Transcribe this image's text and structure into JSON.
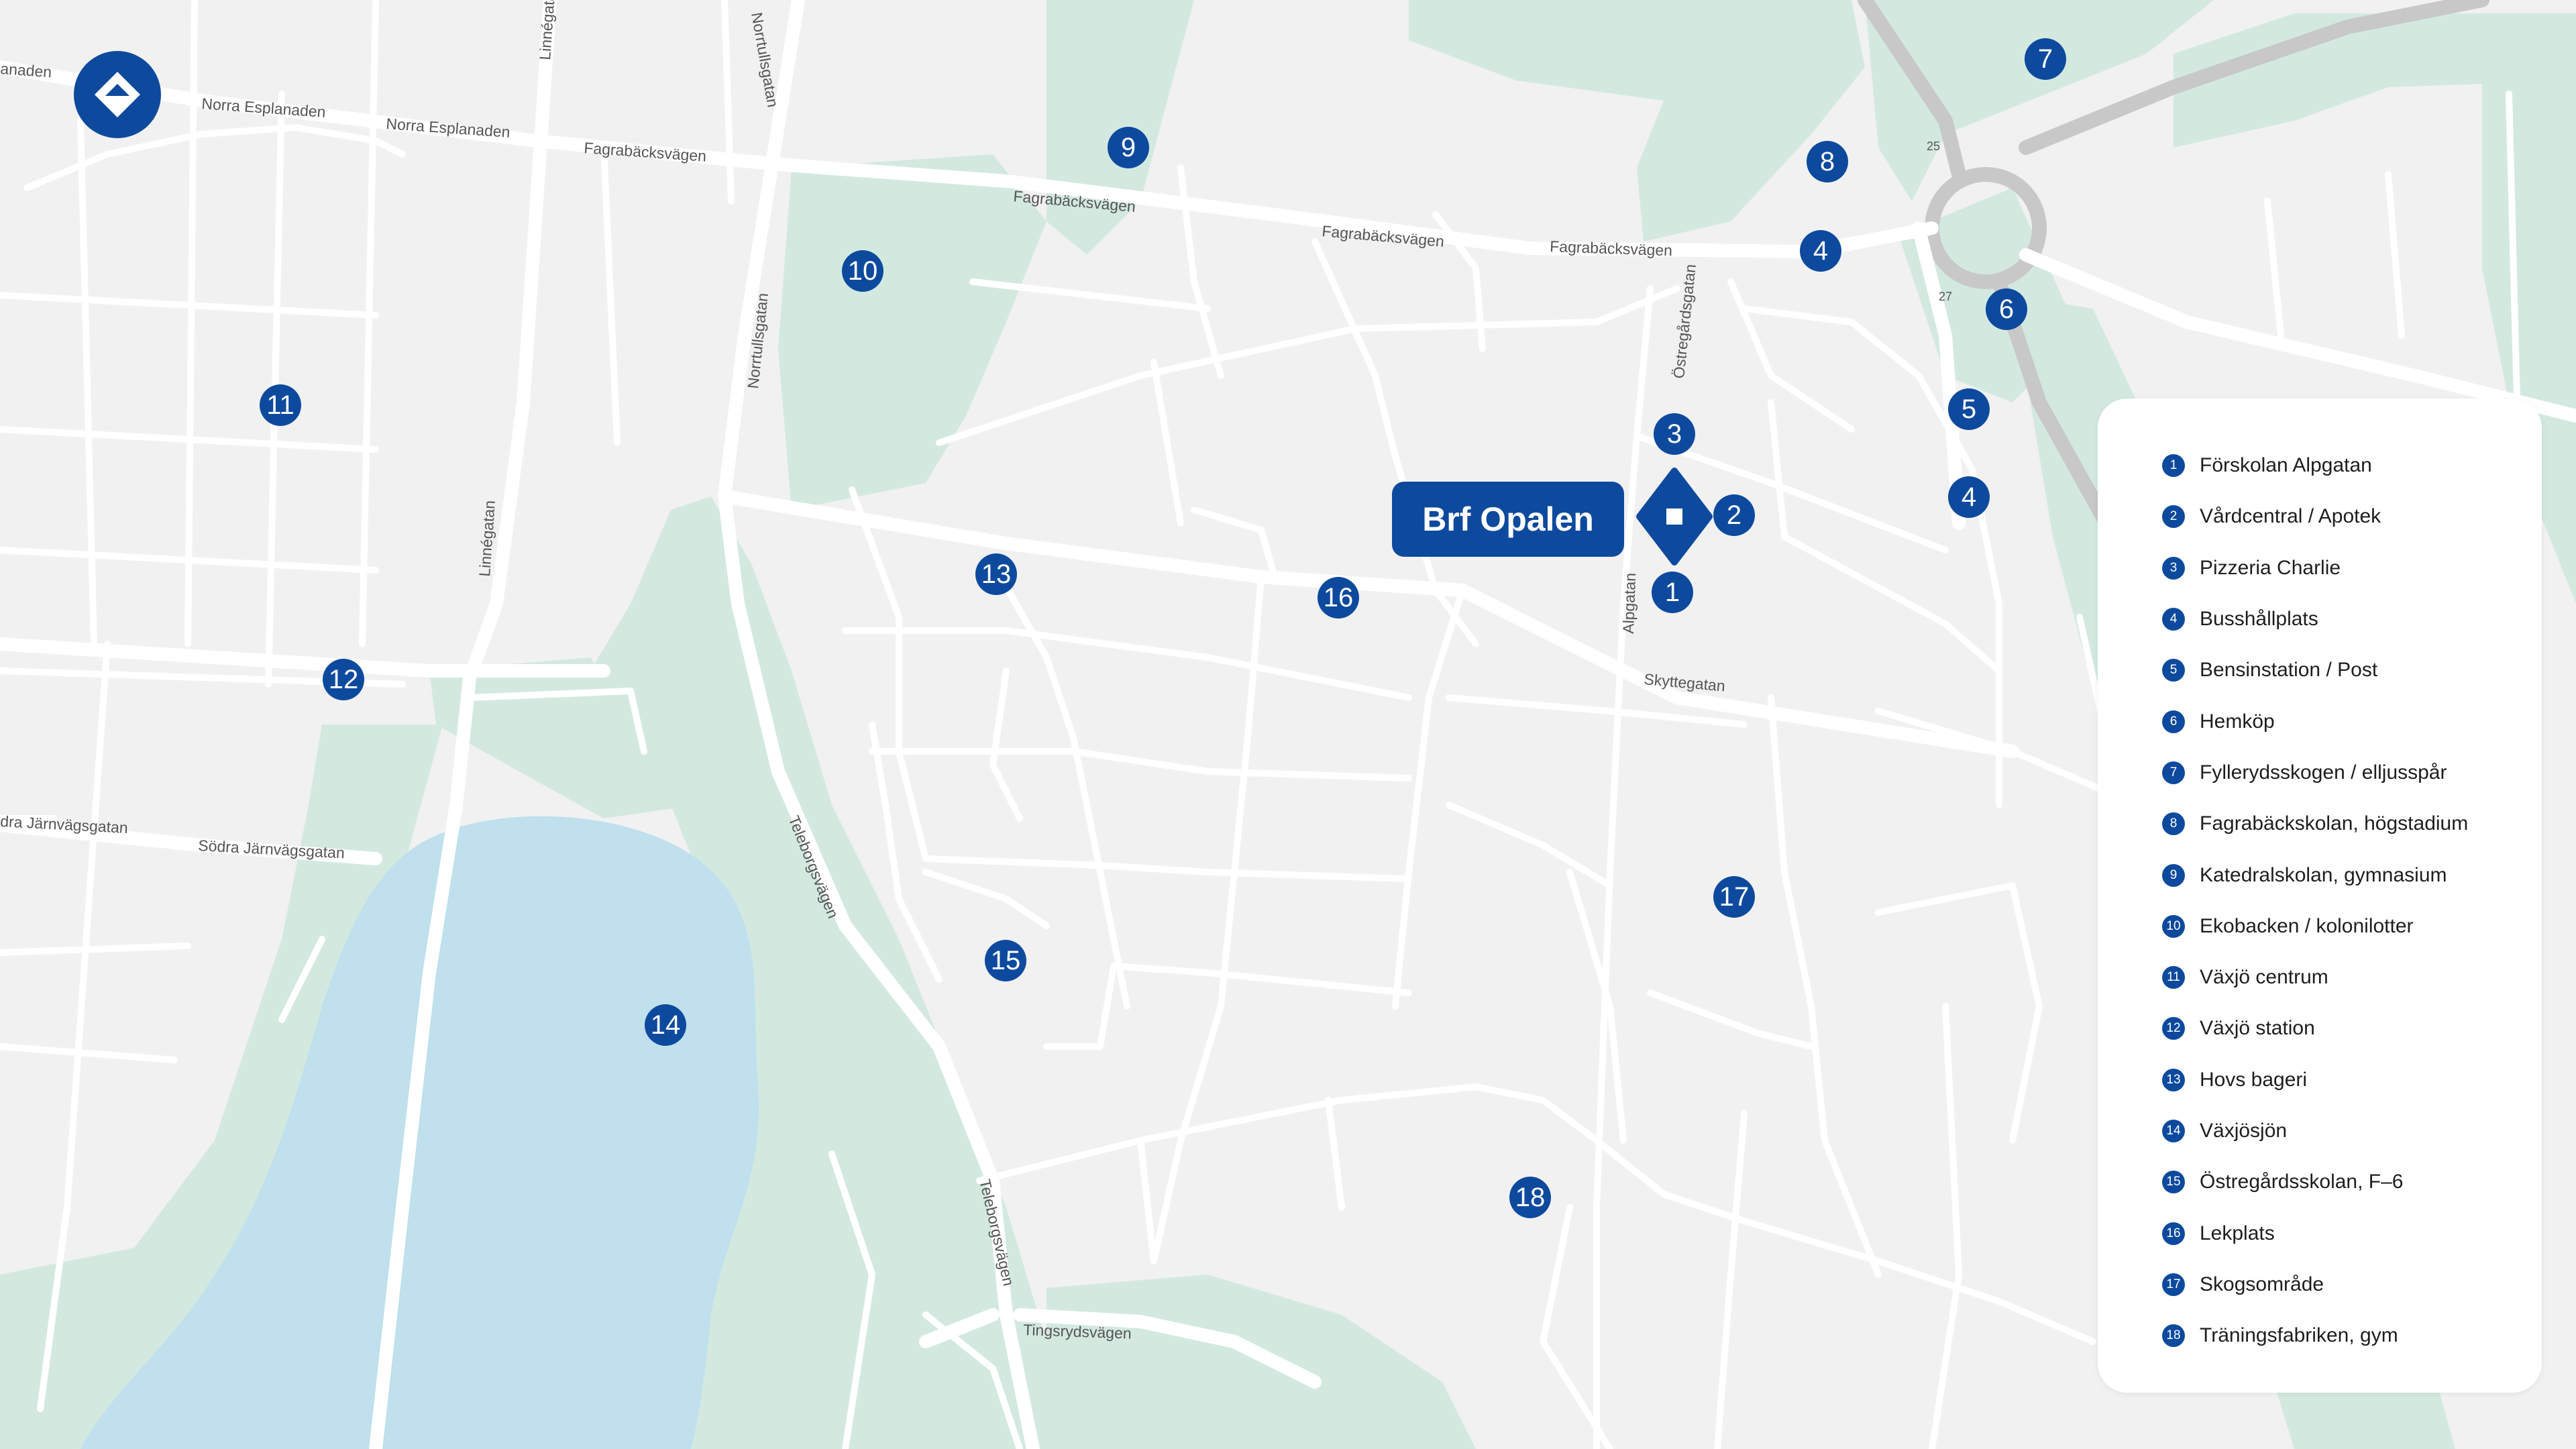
{
  "colors": {
    "accent": "#0d4a9e",
    "park": "#d3e9e0",
    "water": "#bfe0ec",
    "land": "#f1f1f1",
    "road": "#ffffff",
    "highway": "#c8c8c8"
  },
  "logo": {
    "icon": "brand-diamond-icon"
  },
  "property": {
    "label": "Brf Opalen",
    "icon": "property-diamond-icon"
  },
  "streets": [
    "Norra Esplanaden",
    "Norra Esplanaden",
    "anaden",
    "Linnégatan",
    "Norrtullsgatan",
    "Fagrabäcksvägen",
    "Fagrabäcksvägen",
    "Fagrabäcksvägen",
    "Fagrabäcksvägen",
    "Norrtullsgatan",
    "Östregårdsgatan",
    "Linnégatan",
    "Alpgatan",
    "Skyttegatan",
    "dra Järnvägsgatan",
    "Södra Järnvägsgatan",
    "Teleborgsvägen",
    "Teleborgsvägen",
    "Tingsrydsvägen",
    "25",
    "27"
  ],
  "markers": [
    {
      "num": "9"
    },
    {
      "num": "10"
    },
    {
      "num": "11"
    },
    {
      "num": "12"
    },
    {
      "num": "13"
    },
    {
      "num": "16"
    },
    {
      "num": "15"
    },
    {
      "num": "14"
    },
    {
      "num": "18"
    },
    {
      "num": "17"
    },
    {
      "num": "3"
    },
    {
      "num": "2"
    },
    {
      "num": "1"
    },
    {
      "num": "7"
    },
    {
      "num": "8"
    },
    {
      "num": "4"
    },
    {
      "num": "6"
    },
    {
      "num": "5"
    },
    {
      "num": "4"
    }
  ],
  "legend": {
    "items": [
      {
        "num": "1",
        "label": "Förskolan Alpgatan"
      },
      {
        "num": "2",
        "label": "Vårdcentral / Apotek"
      },
      {
        "num": "3",
        "label": "Pizzeria Charlie"
      },
      {
        "num": "4",
        "label": "Busshållplats"
      },
      {
        "num": "5",
        "label": "Bensinstation / Post"
      },
      {
        "num": "6",
        "label": "Hemköp"
      },
      {
        "num": "7",
        "label": "Fyllerydsskogen / elljusspår"
      },
      {
        "num": "8",
        "label": "Fagrabäckskolan, högstadium"
      },
      {
        "num": "9",
        "label": "Katedralskolan, gymnasium"
      },
      {
        "num": "10",
        "label": "Ekobacken / kolonilotter"
      },
      {
        "num": "11",
        "label": "Växjö centrum"
      },
      {
        "num": "12",
        "label": "Växjö station"
      },
      {
        "num": "13",
        "label": "Hovs bageri"
      },
      {
        "num": "14",
        "label": "Växjösjön"
      },
      {
        "num": "15",
        "label": "Östregårdsskolan, F–6"
      },
      {
        "num": "16",
        "label": "Lekplats"
      },
      {
        "num": "17",
        "label": "Skogsområde"
      },
      {
        "num": "18",
        "label": "Träningsfabriken, gym"
      }
    ]
  }
}
